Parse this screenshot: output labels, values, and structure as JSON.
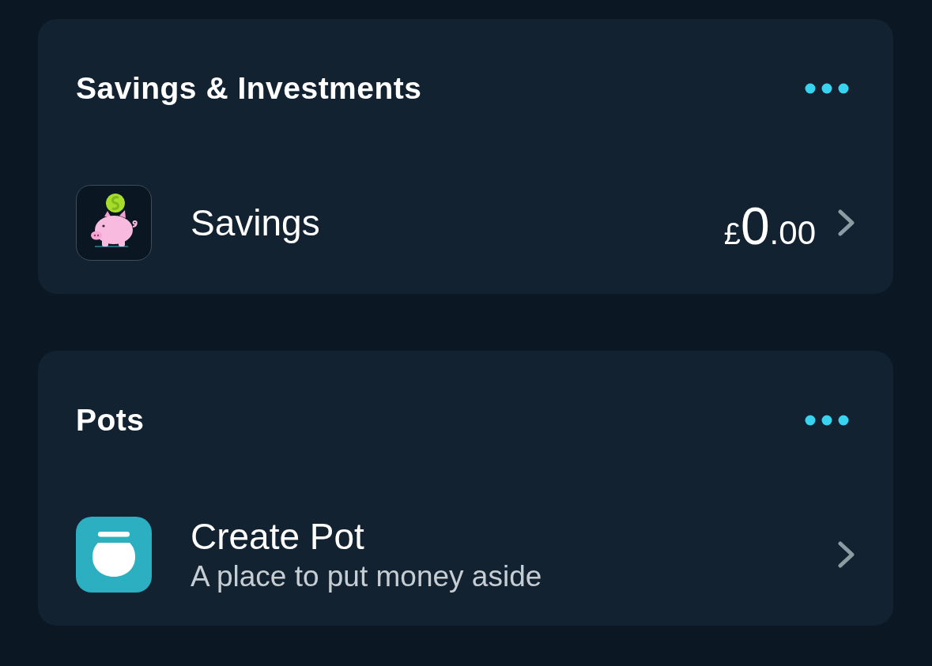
{
  "sections": [
    {
      "title": "Savings & Investments",
      "items": [
        {
          "kind": "account",
          "label": "Savings",
          "amount": {
            "currency": "£",
            "whole": "0",
            "fraction": ".00"
          }
        }
      ]
    },
    {
      "title": "Pots",
      "items": [
        {
          "kind": "create",
          "label": "Create Pot",
          "subtitle": "A place to put money aside"
        }
      ]
    }
  ]
}
